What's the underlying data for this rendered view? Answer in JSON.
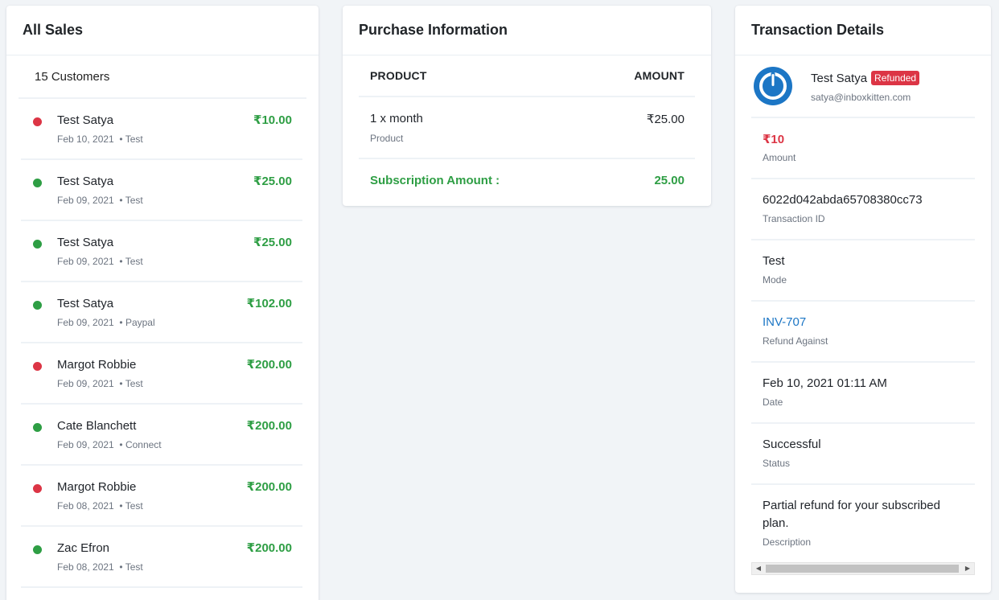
{
  "sales": {
    "title": "All Sales",
    "customers_count": "15 Customers",
    "items": [
      {
        "name": "Test Satya",
        "date": "Feb 10, 2021",
        "mode": "• Test",
        "amount": "₹10.00",
        "status_color": "#dc3545"
      },
      {
        "name": "Test Satya",
        "date": "Feb 09, 2021",
        "mode": "• Test",
        "amount": "₹25.00",
        "status_color": "#2e9e44"
      },
      {
        "name": "Test Satya",
        "date": "Feb 09, 2021",
        "mode": "• Test",
        "amount": "₹25.00",
        "status_color": "#2e9e44"
      },
      {
        "name": "Test Satya",
        "date": "Feb 09, 2021",
        "mode": "• Paypal",
        "amount": "₹102.00",
        "status_color": "#2e9e44"
      },
      {
        "name": "Margot Robbie",
        "date": "Feb 09, 2021",
        "mode": "• Test",
        "amount": "₹200.00",
        "status_color": "#dc3545"
      },
      {
        "name": "Cate Blanchett",
        "date": "Feb 09, 2021",
        "mode": "• Connect",
        "amount": "₹200.00",
        "status_color": "#2e9e44"
      },
      {
        "name": "Margot Robbie",
        "date": "Feb 08, 2021",
        "mode": "• Test",
        "amount": "₹200.00",
        "status_color": "#dc3545"
      },
      {
        "name": "Zac Efron",
        "date": "Feb 08, 2021",
        "mode": "• Test",
        "amount": "₹200.00",
        "status_color": "#2e9e44"
      }
    ]
  },
  "purchase": {
    "title": "Purchase Information",
    "col_product": "PRODUCT",
    "col_amount": "AMOUNT",
    "product": "1 x month",
    "product_label": "Product",
    "amount": "₹25.00",
    "subscription_label": "Subscription Amount :",
    "subscription_amount": "25.00"
  },
  "transaction": {
    "title": "Transaction Details",
    "user_name": "Test Satya",
    "badge": "Refunded",
    "email": "satya@inboxkitten.com",
    "amount": "₹10",
    "amount_label": "Amount",
    "transaction_id": "6022d042abda65708380cc73",
    "transaction_id_label": "Transaction ID",
    "mode": "Test",
    "mode_label": "Mode",
    "refund_against": "INV-707",
    "refund_against_label": "Refund Against",
    "date": "Feb 10, 2021 01:11 AM",
    "date_label": "Date",
    "status": "Successful",
    "status_label": "Status",
    "description": "Partial refund for your subscribed plan.",
    "description_label": "Description",
    "avatar_icon": "power-icon"
  },
  "colors": {
    "success": "#2e9e44",
    "danger": "#dc3545",
    "link": "#1c76c5"
  }
}
